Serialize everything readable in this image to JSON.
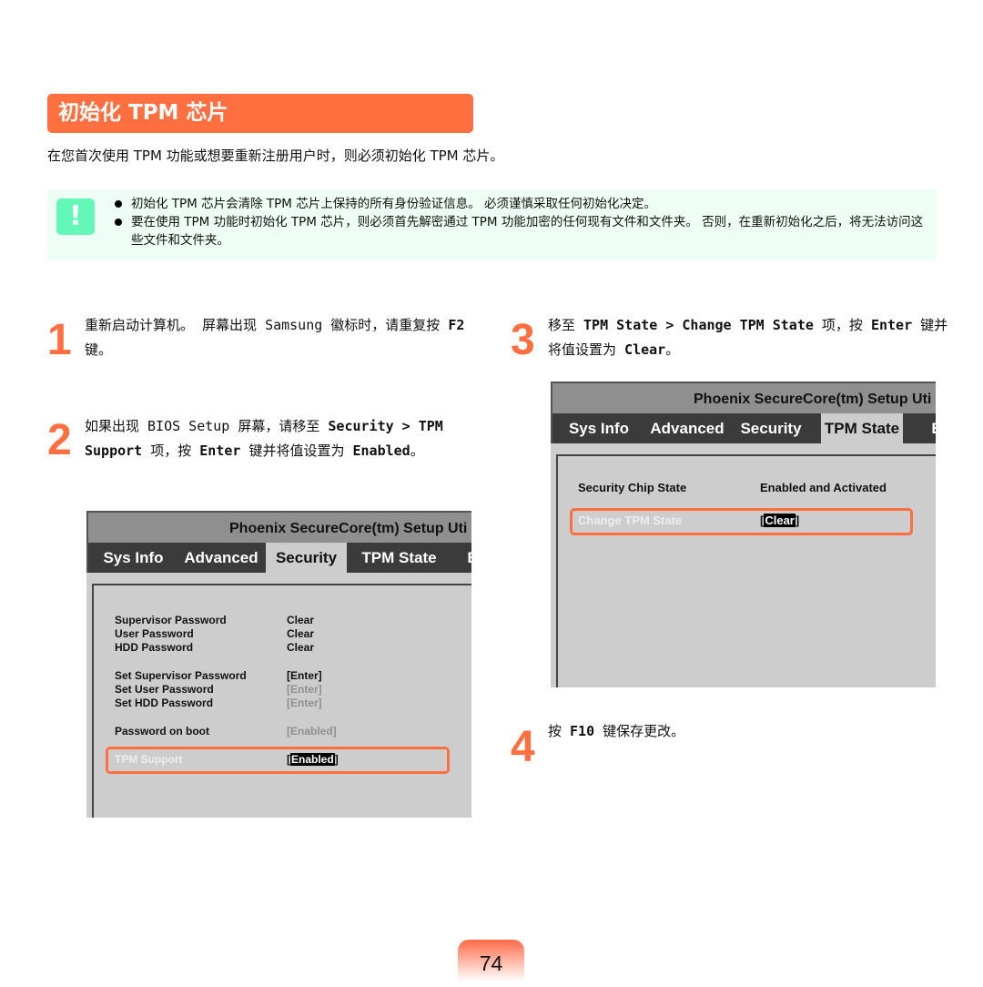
{
  "title": "初始化 TPM 芯片",
  "intro": "在您首次使用 TPM 功能或想要重新注册用户时，则必须初始化 TPM 芯片。",
  "note": {
    "icon": "!",
    "items": [
      "初始化 TPM 芯片会清除 TPM 芯片上保持的所有身份验证信息。 必须谨慎采取任何初始化决定。",
      "要在使用 TPM 功能时初始化 TPM 芯片，则必须首先解密通过 TPM 功能加密的任何现有文件和文件夹。 否则，在重新初始化之后，将无法访问这些文件和文件夹。"
    ]
  },
  "steps": [
    {
      "num": "1",
      "parts": [
        "重新启动计算机。 屏幕出现 Samsung 徽标时，请重复按 ",
        "F2",
        " 键。"
      ]
    },
    {
      "num": "2",
      "parts": [
        "如果出现 BIOS Setup 屏幕，请移至 ",
        "Security > TPM Support",
        " 项，按 ",
        "Enter",
        " 键并将值设置为 ",
        "Enabled",
        "。"
      ]
    },
    {
      "num": "3",
      "parts": [
        "移至 ",
        "TPM State > Change TPM State",
        " 项，按 ",
        "Enter",
        " 键并将值设置为 ",
        "Clear",
        "。"
      ]
    },
    {
      "num": "4",
      "parts": [
        "按 ",
        "F10",
        " 键保存更改。"
      ]
    }
  ],
  "bios": {
    "title": "Phoenix SecureCore(tm) Setup Uti",
    "tabs": [
      "Sys Info",
      "Advanced",
      "Security",
      "TPM State",
      "E"
    ],
    "security": {
      "rows": [
        [
          "Supervisor Password",
          "Clear"
        ],
        [
          "User Password",
          "Clear"
        ],
        [
          "HDD Password",
          "Clear"
        ],
        [
          "Set Supervisor Password",
          "[Enter]"
        ],
        [
          "Set User Password",
          "[Enter]"
        ],
        [
          "Set HDD Password",
          "[Enter]"
        ],
        [
          "Password on boot",
          "[Enabled]"
        ],
        [
          "TPM Support",
          "Enabled"
        ]
      ]
    },
    "tpm": {
      "rows": [
        [
          "Security Chip State",
          "Enabled and Activated"
        ],
        [
          "Change TPM State",
          "Clear"
        ]
      ]
    }
  },
  "accent": "#ff6f3f",
  "page_number": "74"
}
